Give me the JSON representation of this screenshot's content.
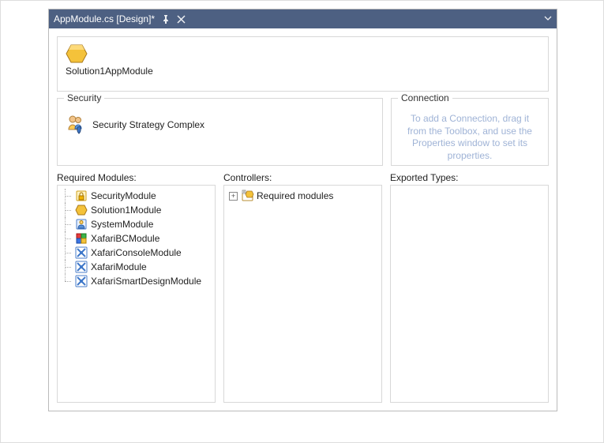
{
  "titlebar": {
    "title": "AppModule.cs [Design]*"
  },
  "module": {
    "name": "Solution1AppModule"
  },
  "security": {
    "group_label": "Security",
    "strategy": "Security Strategy Complex"
  },
  "connection": {
    "group_label": "Connection",
    "placeholder": "To add a Connection, drag it from the Toolbox, and use the Properties window to set its properties."
  },
  "lists": {
    "required_modules_label": "Required Modules:",
    "controllers_label": "Controllers:",
    "exported_types_label": "Exported Types:",
    "required_modules": [
      {
        "label": "SecurityModule",
        "icon": "lock"
      },
      {
        "label": "Solution1Module",
        "icon": "hex"
      },
      {
        "label": "SystemModule",
        "icon": "sys"
      },
      {
        "label": "XafariBCModule",
        "icon": "blocks"
      },
      {
        "label": "XafariConsoleModule",
        "icon": "xafari"
      },
      {
        "label": "XafariModule",
        "icon": "xafari"
      },
      {
        "label": "XafariSmartDesignModule",
        "icon": "xafari"
      }
    ],
    "controllers_root": "Required modules"
  }
}
